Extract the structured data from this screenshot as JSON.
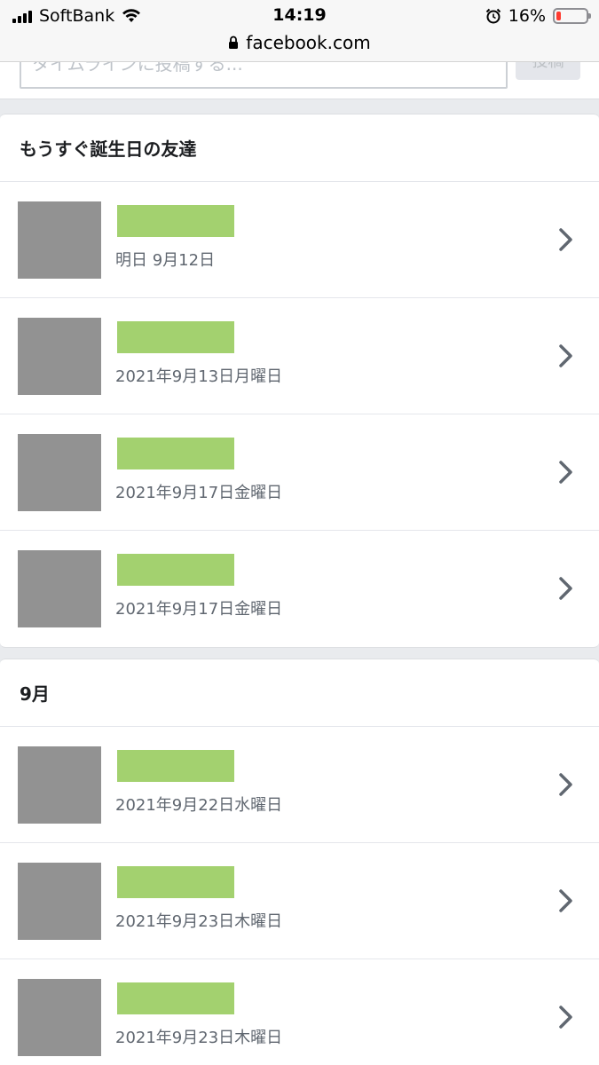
{
  "status_bar": {
    "carrier": "SoftBank",
    "time": "14:19",
    "battery_percent": "16%",
    "battery_level": 0.16
  },
  "url_bar": {
    "domain": "facebook.com"
  },
  "compose": {
    "placeholder_partial": "タイムラインに投稿する...",
    "button_label": "投稿"
  },
  "upcoming_section": {
    "title": "もうすぐ誕生日の友達",
    "friends": [
      {
        "date": "明日 9月12日"
      },
      {
        "date": "2021年9月13日月曜日"
      },
      {
        "date": "2021年9月17日金曜日"
      },
      {
        "date": "2021年9月17日金曜日"
      }
    ]
  },
  "month_section": {
    "title": "9月",
    "friends": [
      {
        "date": "2021年9月22日水曜日"
      },
      {
        "date": "2021年9月23日木曜日"
      },
      {
        "date": "2021年9月23日木曜日"
      }
    ]
  },
  "colors": {
    "redaction_green": "#a3d16f",
    "avatar_gray": "#929292",
    "chevron": "#606770"
  }
}
